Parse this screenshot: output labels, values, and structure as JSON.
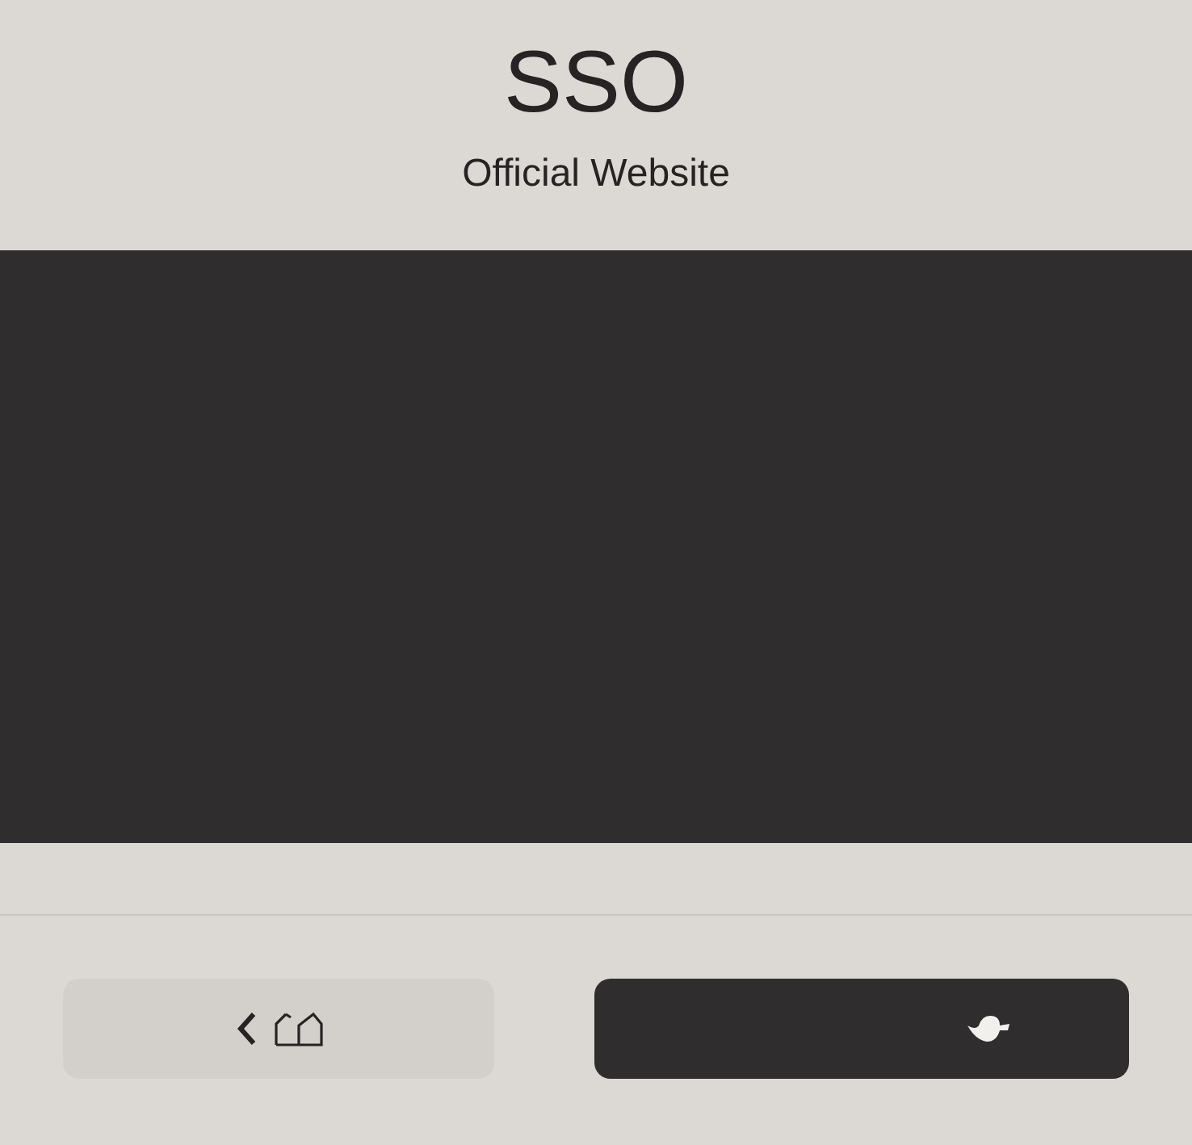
{
  "header": {
    "title": "SSO",
    "subtitle": "Official Website"
  },
  "media": {
    "kind": "empty"
  },
  "buttons": [
    {
      "kind": "back-home"
    },
    {
      "kind": "primary"
    }
  ]
}
